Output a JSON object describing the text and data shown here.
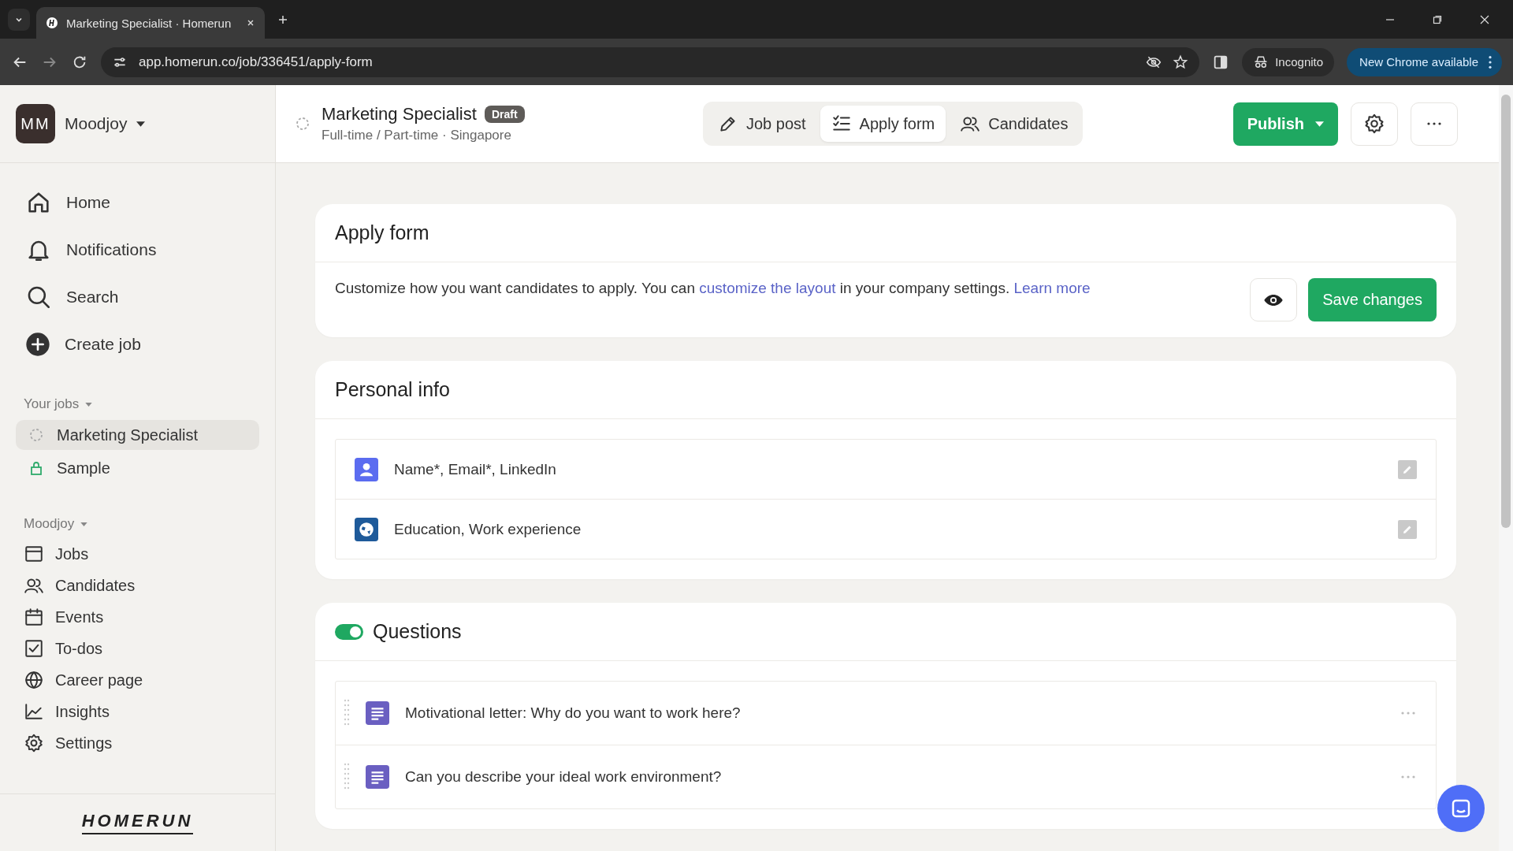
{
  "browser": {
    "tabs": [
      {
        "title": "Marketing Specialist · Homerun",
        "selected": true
      }
    ],
    "url": "app.homerun.co/job/336451/apply-form",
    "incognito": "Incognito",
    "update_button": "New Chrome available"
  },
  "sidebar": {
    "workspace": {
      "initials": "MM",
      "name": "Moodjoy"
    },
    "nav": [
      {
        "label": "Home",
        "kind": "home"
      },
      {
        "label": "Notifications",
        "kind": "bell"
      },
      {
        "label": "Search",
        "kind": "search"
      },
      {
        "label": "Create job",
        "kind": "plus"
      }
    ],
    "your_jobs": {
      "heading": "Your jobs",
      "items": [
        {
          "label": "Marketing Specialist",
          "kind": "draft",
          "selected": true
        },
        {
          "label": "Sample",
          "kind": "locked",
          "selected": false
        }
      ]
    },
    "company": {
      "heading": "Moodjoy",
      "items": [
        {
          "label": "Jobs",
          "kind": "window"
        },
        {
          "label": "Candidates",
          "kind": "people"
        },
        {
          "label": "Events",
          "kind": "calendar"
        },
        {
          "label": "To-dos",
          "kind": "check"
        },
        {
          "label": "Career page",
          "kind": "globe"
        },
        {
          "label": "Insights",
          "kind": "chart"
        },
        {
          "label": "Settings",
          "kind": "gear"
        }
      ]
    },
    "logo": "HOMERUN"
  },
  "header": {
    "title": "Marketing Specialist",
    "badge": "Draft",
    "subtitle": "Full-time / Part-time · Singapore",
    "tabs": [
      {
        "label": "Job post",
        "kind": "pencil",
        "selected": false
      },
      {
        "label": "Apply form",
        "kind": "list",
        "selected": true
      },
      {
        "label": "Candidates",
        "kind": "people",
        "selected": false
      }
    ],
    "publish_button": "Publish"
  },
  "apply_form": {
    "title": "Apply form",
    "description": [
      {
        "kind": "text",
        "text": "Customize how you want candidates to apply. You can "
      },
      {
        "kind": "link",
        "text": "customize the layout"
      },
      {
        "kind": "text",
        "text": " in your company settings. "
      },
      {
        "kind": "link",
        "text": "Learn more"
      }
    ],
    "save_button": "Save changes"
  },
  "personal_info": {
    "title": "Personal info",
    "items": [
      {
        "label": "Name*, Email*, LinkedIn",
        "kind": "person"
      },
      {
        "label": "Education, Work experience",
        "kind": "globe"
      }
    ]
  },
  "questions": {
    "title": "Questions",
    "enabled": true,
    "items": [
      {
        "label": "Motivational letter: Why do you want to work here?"
      },
      {
        "label": "Can you describe your ideal work environment?"
      }
    ]
  }
}
